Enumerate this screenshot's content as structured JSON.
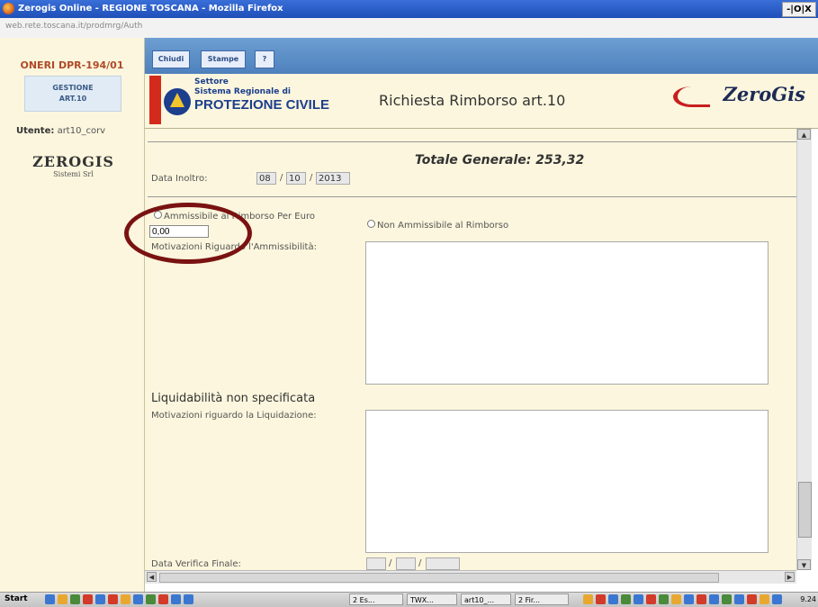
{
  "window": {
    "title": "Zerogis Online - REGIONE TOSCANA - Mozilla Firefox",
    "buttons": "-|O|X"
  },
  "address": {
    "url": "web.rete.toscana.it/prodmrg/Auth"
  },
  "sidebar": {
    "title": "ONERI DPR-194/01",
    "gestione": {
      "line1": "GESTIONE",
      "line2": "ART.10"
    },
    "user_label": "Utente:",
    "user_value": "art10_corv",
    "logo_big": "ZEROGIS",
    "logo_small": "Sistemi Srl"
  },
  "toolbar": {
    "chiudi": "Chiudi",
    "stampe": "Stampe",
    "help": "?"
  },
  "header": {
    "pc_line1": "Settore",
    "pc_line2": "Sistema Regionale di",
    "pc_line3": "PROTEZIONE CIVILE",
    "title": "Richiesta Rimborso art.10",
    "zerogis": "ZeroGis"
  },
  "form": {
    "totale": "Totale Generale: 253,32",
    "data_inoltro_label": "Data Inoltro:",
    "data_inoltro": {
      "dd": "08",
      "mm": "10",
      "yyyy": "2013"
    },
    "radio_ammissibile": "Ammissibile al Rimborso Per Euro",
    "importo": "0,00",
    "radio_non_ammissibile": "Non Ammissibile al Rimborso",
    "motivazioni_ammissibilita_label": "Motivazioni Riguardo l'Ammissibilità:",
    "liquidabilita_heading": "Liquidabilità non specificata",
    "motivazioni_liquidazione_label": "Motivazioni riguardo la Liquidazione:",
    "data_verifica_label": "Data Verifica Finale:"
  },
  "taskbar": {
    "start": "Start",
    "tasks": [
      "2 Es...",
      "TWX...",
      "art10_...",
      "2 Fir..."
    ],
    "clock": "9.24"
  },
  "colors": {
    "annotation": "#7a1212",
    "toolbar": "#5a8cc8",
    "panel": "#fbf6dd"
  }
}
